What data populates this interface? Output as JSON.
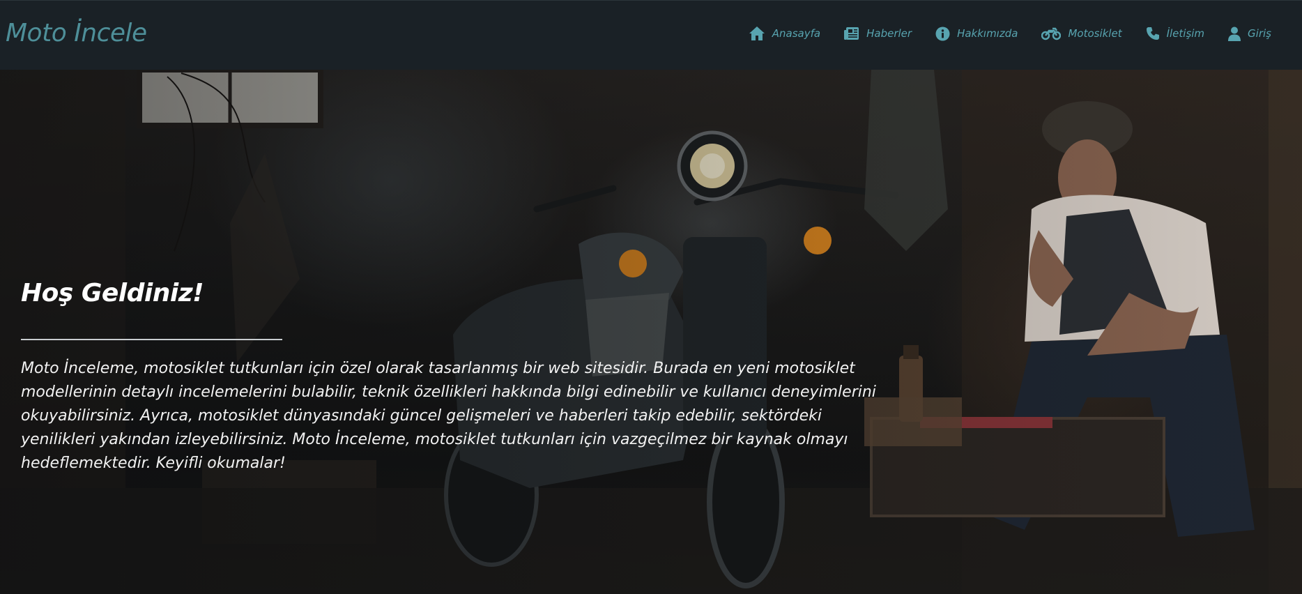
{
  "brand": {
    "title": "Moto İncele"
  },
  "nav": {
    "items": [
      {
        "icon": "home-icon",
        "label": "Anasayfa"
      },
      {
        "icon": "newspaper-icon",
        "label": "Haberler"
      },
      {
        "icon": "info-icon",
        "label": "Hakkımızda"
      },
      {
        "icon": "motorcycle-icon",
        "label": "Motosiklet"
      },
      {
        "icon": "phone-icon",
        "label": "İletişim"
      },
      {
        "icon": "user-icon",
        "label": "Giriş"
      }
    ]
  },
  "hero": {
    "title": "Hoş Geldiniz!",
    "text": "Moto İnceleme, motosiklet tutkunları için özel olarak tasarlanmış bir web sitesidir. Burada en yeni motosiklet modellerinin detaylı incelemelerini bulabilir, teknik özellikleri hakkında bilgi edinebilir ve kullanıcı deneyimlerini okuyabilirsiniz. Ayrıca, motosiklet dünyasındaki güncel gelişmeleri ve haberleri takip edebilir, sektördeki yenilikleri yakından izleyebilirsiniz. Moto İnceleme, motosiklet tutkunları için vazgeçilmez bir kaynak olmayı hedeflemektedir. Keyifli okumalar!",
    "background": "garage-motorcycle-photo"
  },
  "colors": {
    "navbar_bg": "#1a2126",
    "accent": "#58a4b0",
    "brand": "#4e8f99",
    "hero_text": "#ffffff"
  }
}
